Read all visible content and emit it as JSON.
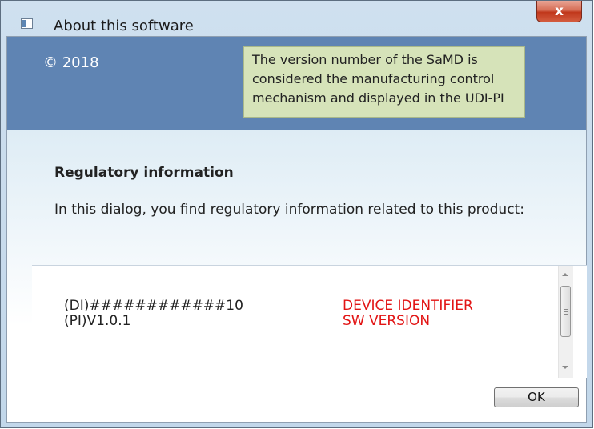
{
  "window": {
    "title": "About this software",
    "close_glyph": "x",
    "icon": "app-window-icon"
  },
  "banner": {
    "copyright": "© 2018",
    "note": "The version number of the SaMD is considered the manufacturing control mechanism and displayed in the UDI-PI",
    "note_color": "#d6e3b9",
    "banner_color": "#5f84b3"
  },
  "content": {
    "heading": "Regulatory information",
    "intro": "In this dialog, you find regulatory information related to this product:"
  },
  "udi": {
    "rows": [
      {
        "code": "(DI)############10",
        "label": "DEVICE IDENTIFIER"
      },
      {
        "code": "(PI)V1.0.1",
        "label": "SW VERSION"
      }
    ],
    "label_color": "#e21414"
  },
  "buttons": {
    "ok_label": "OK"
  }
}
